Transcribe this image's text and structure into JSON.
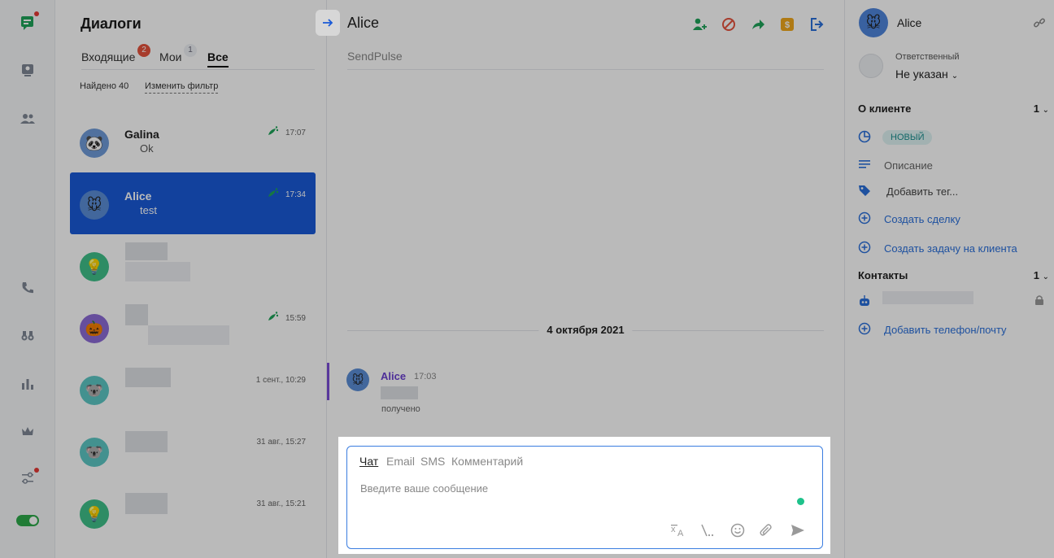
{
  "colors": {
    "accent": "#1a5ad7",
    "badge_red": "#e5533d",
    "online": "#1ec28b",
    "author": "#6a3fd1",
    "tag_new_bg": "#dff3f3"
  },
  "rail": {
    "icons": [
      "chat-logo-icon",
      "monitor-icon",
      "users-icon",
      "phone-icon",
      "binoculars-icon",
      "analytics-icon",
      "crown-icon",
      "sliders-icon",
      "toggle-icon"
    ]
  },
  "dialogs": {
    "title": "Диалоги",
    "tabs": [
      {
        "label": "Входящие",
        "badge": "2"
      },
      {
        "label": "Мои",
        "badge": "1"
      },
      {
        "label": "Все",
        "badge": ""
      }
    ],
    "found": "Найдено 40",
    "change_filter": "Изменить фильтр",
    "items": [
      {
        "name": "Galina",
        "message": "Ok",
        "time": "17:07",
        "avatar": "panda"
      },
      {
        "name": "Alice",
        "message": "test",
        "time": "17:34",
        "avatar": "mouse"
      },
      {
        "name": "",
        "message": "",
        "time": "",
        "avatar": "bulb"
      },
      {
        "name": "",
        "message": "",
        "time": "15:59",
        "avatar": "pumpkin"
      },
      {
        "name": "",
        "message": "",
        "time": "1 сент., 10:29",
        "avatar": "koala"
      },
      {
        "name": "",
        "message": "",
        "time": "31 авг., 15:27",
        "avatar": "koala"
      },
      {
        "name": "",
        "message": "",
        "time": "31 авг., 15:21",
        "avatar": "bulb"
      }
    ]
  },
  "chat": {
    "title": "Alice",
    "source": "SendPulse",
    "date_separator": "4 октября 2021",
    "message": {
      "author": "Alice",
      "time": "17:03",
      "status": "получено"
    },
    "composer": {
      "tabs": [
        "Чат",
        "Email",
        "SMS",
        "Комментарий"
      ],
      "placeholder": "Введите ваше сообщение"
    }
  },
  "contact_panel": {
    "name": "Alice",
    "responsible_label": "Ответственный",
    "responsible_value": "Не указан",
    "about_title": "О клиенте",
    "about_count": "1",
    "status_tag": "НОВЫЙ",
    "description": "Описание",
    "add_tag": "Добавить тег...",
    "create_deal": "Создать сделку",
    "create_task": "Создать задачу на клиента",
    "contacts_title": "Контакты",
    "contacts_count": "1",
    "add_phone": "Добавить телефон/почту"
  }
}
